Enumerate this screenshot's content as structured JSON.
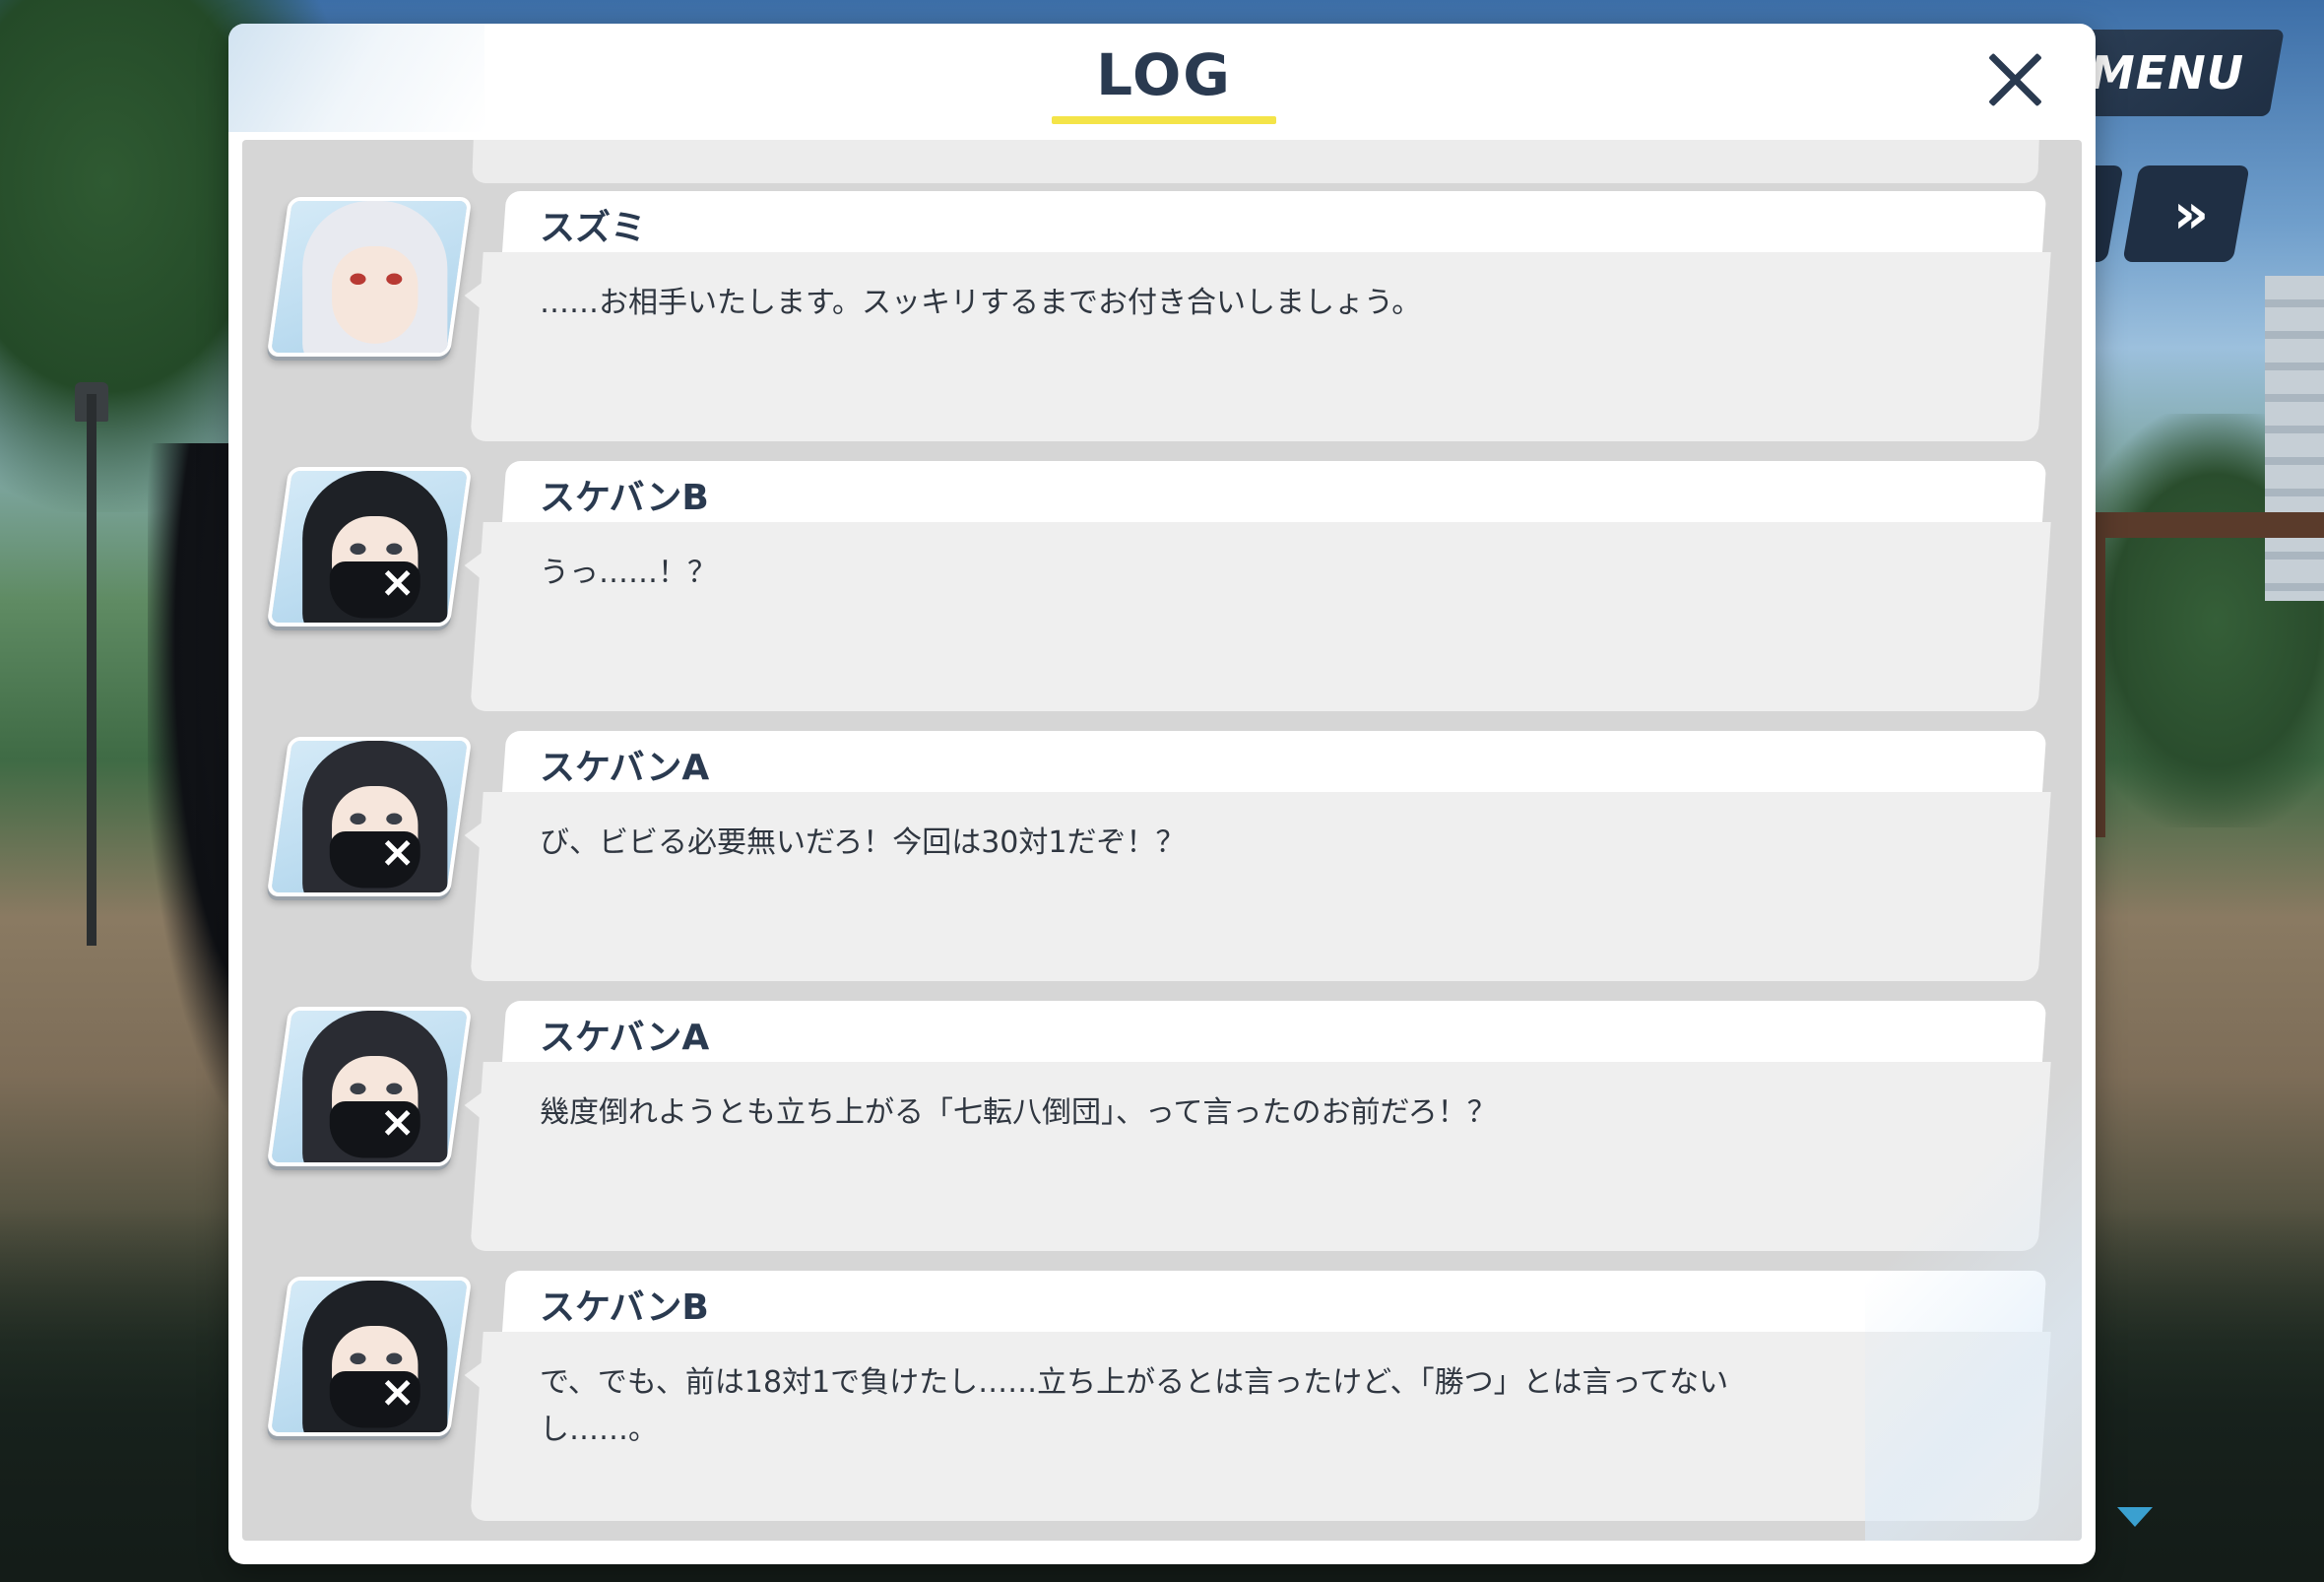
{
  "colors": {
    "title_text": "#2a3a50",
    "title_underline": "#f4e448",
    "log_background": "#d6d6d6",
    "bubble_text_bg": "#efefef",
    "hud_button": "#1f2f44",
    "scroll_arrow": "#3aa0d0"
  },
  "hud": {
    "menu_label": "MENU",
    "fast_forward_icon": "»",
    "icons": [
      "fast-forward-icon",
      "auto-icon"
    ]
  },
  "dialog": {
    "title": "LOG",
    "close_icon": "close-icon"
  },
  "entries": [
    {
      "speaker": "スズミ",
      "text": "……お相手いたします。スッキリするまでお付き合いしましょう。",
      "portrait": "suzumi-portrait"
    },
    {
      "speaker": "スケバンB",
      "text": "うっ……！？",
      "portrait": "sukeban-b-portrait"
    },
    {
      "speaker": "スケバンA",
      "text": "び、ビビる必要無いだろ！今回は30対1だぞ！？",
      "portrait": "sukeban-a-portrait"
    },
    {
      "speaker": "スケバンA",
      "text": "幾度倒れようとも立ち上がる「七転八倒団」、って言ったのお前だろ！？",
      "portrait": "sukeban-a-portrait"
    },
    {
      "speaker": "スケバンB",
      "text": "で、でも、前は18対1で負けたし……立ち上がるとは言ったけど、「勝つ」とは言ってない\nし……。",
      "portrait": "sukeban-b-portrait"
    }
  ]
}
